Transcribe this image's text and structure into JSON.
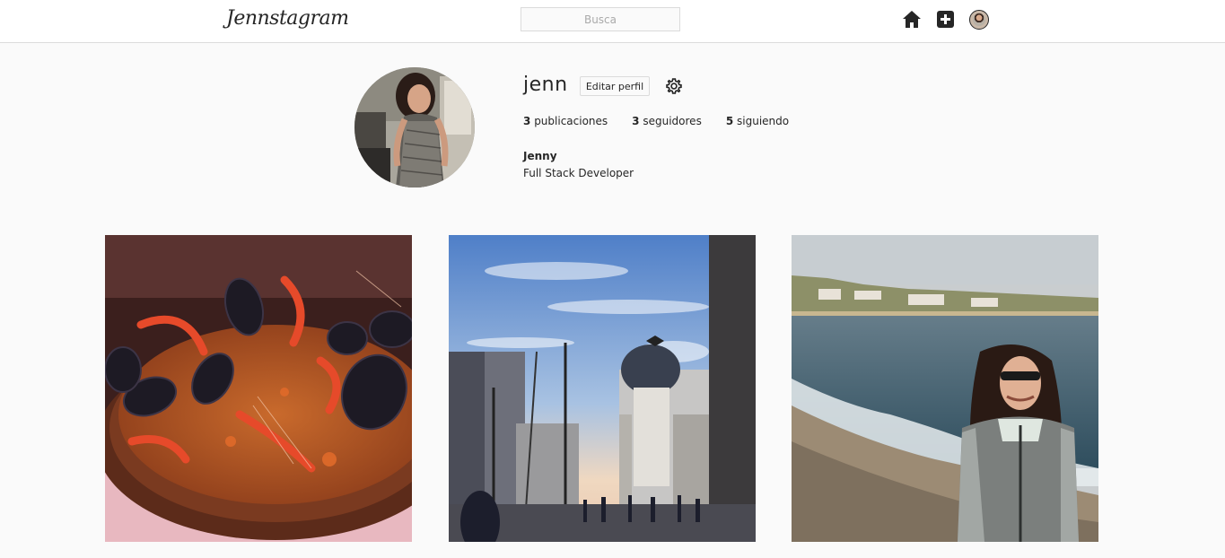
{
  "navbar": {
    "logo": "Jennstagram",
    "search_placeholder": "Busca",
    "icons": [
      "home-icon",
      "add-post-icon",
      "profile-avatar"
    ]
  },
  "profile": {
    "username": "jenn",
    "edit_button": "Editar perfil",
    "stats": [
      {
        "count": "3",
        "label": "publicaciones"
      },
      {
        "count": "3",
        "label": "seguidores"
      },
      {
        "count": "5",
        "label": "siguiendo"
      }
    ],
    "full_name": "Jenny",
    "bio": "Full Stack Developer"
  },
  "posts": [
    {
      "subject": "paella"
    },
    {
      "subject": "city-building"
    },
    {
      "subject": "beach-portrait"
    }
  ],
  "colors": {
    "background": "#fafafa",
    "navbar_bg": "#ffffff",
    "border": "#dbdbdb",
    "text": "#262626"
  }
}
